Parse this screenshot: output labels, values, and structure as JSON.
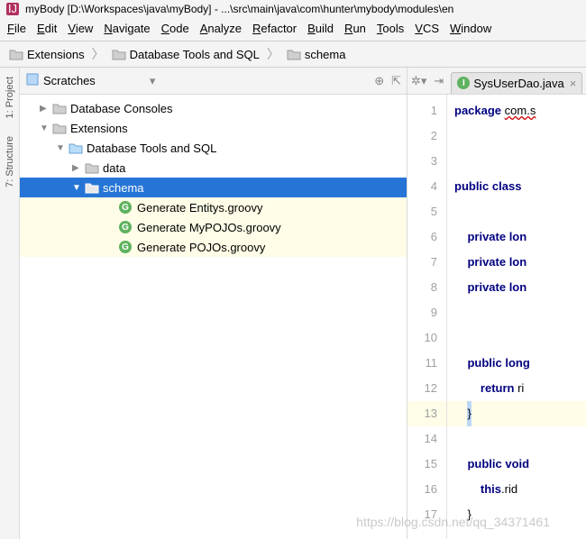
{
  "title": "myBody [D:\\Workspaces\\java\\myBody] - ...\\src\\main\\java\\com\\hunter\\mybody\\modules\\en",
  "menu": [
    "File",
    "Edit",
    "View",
    "Navigate",
    "Code",
    "Analyze",
    "Refactor",
    "Build",
    "Run",
    "Tools",
    "VCS",
    "Window"
  ],
  "breadcrumbs": [
    "Extensions",
    "Database Tools and SQL",
    "schema"
  ],
  "sidebar_tabs": [
    "1: Project",
    "7: Structure"
  ],
  "tree_header": {
    "title": "Scratches"
  },
  "tree": {
    "db_consoles": "Database Consoles",
    "extensions": "Extensions",
    "db_tools": "Database Tools and SQL",
    "data": "data",
    "schema": "schema",
    "g1": "Generate Entitys.groovy",
    "g2": "Generate MyPOJOs.groovy",
    "g3": "Generate POJOs.groovy"
  },
  "editor": {
    "tab_name": "SysUserDao.java",
    "lines": [
      {
        "n": 1,
        "tokens": [
          {
            "t": "package ",
            "c": "kw"
          },
          {
            "t": "com.s",
            "c": "err"
          }
        ]
      },
      {
        "n": 2,
        "tokens": []
      },
      {
        "n": 3,
        "tokens": []
      },
      {
        "n": 4,
        "tokens": [
          {
            "t": "public class ",
            "c": "kw"
          }
        ]
      },
      {
        "n": 5,
        "tokens": []
      },
      {
        "n": 6,
        "tokens": [
          {
            "t": "    "
          },
          {
            "t": "private lon",
            "c": "kw"
          }
        ]
      },
      {
        "n": 7,
        "tokens": [
          {
            "t": "    "
          },
          {
            "t": "private lon",
            "c": "kw"
          }
        ]
      },
      {
        "n": 8,
        "tokens": [
          {
            "t": "    "
          },
          {
            "t": "private lon",
            "c": "kw"
          }
        ]
      },
      {
        "n": 9,
        "tokens": []
      },
      {
        "n": 10,
        "tokens": []
      },
      {
        "n": 11,
        "tokens": [
          {
            "t": "    "
          },
          {
            "t": "public long",
            "c": "kw"
          }
        ]
      },
      {
        "n": 12,
        "tokens": [
          {
            "t": "        "
          },
          {
            "t": "return ",
            "c": "kw"
          },
          {
            "t": "ri"
          }
        ]
      },
      {
        "n": 13,
        "tokens": [
          {
            "t": "    "
          },
          {
            "t": "}",
            "c": "brace-hl"
          }
        ],
        "hl": true
      },
      {
        "n": 14,
        "tokens": []
      },
      {
        "n": 15,
        "tokens": [
          {
            "t": "    "
          },
          {
            "t": "public void",
            "c": "kw"
          }
        ]
      },
      {
        "n": 16,
        "tokens": [
          {
            "t": "        "
          },
          {
            "t": "this",
            "c": "kw"
          },
          {
            "t": ".rid"
          }
        ]
      },
      {
        "n": 17,
        "tokens": [
          {
            "t": "    }"
          }
        ]
      }
    ]
  },
  "watermark": "https://blog.csdn.net/qq_34371461"
}
